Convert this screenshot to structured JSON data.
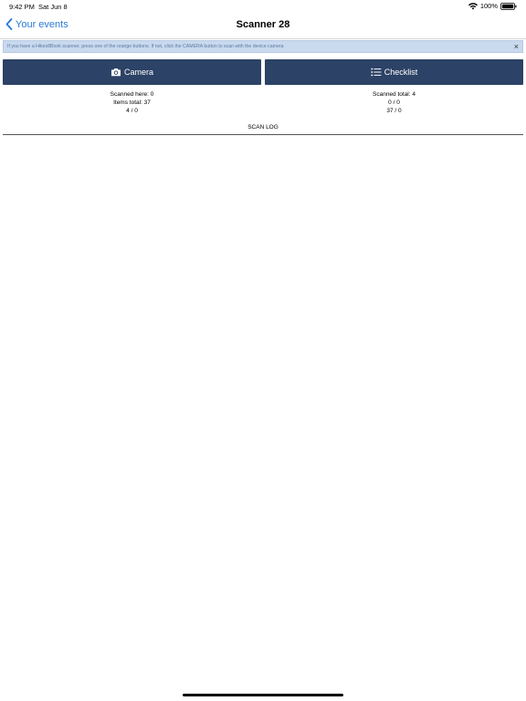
{
  "status_bar": {
    "time": "9:42 PM",
    "date": "Sat Jun 8",
    "battery": "100%"
  },
  "nav": {
    "back_label": "Your events",
    "title": "Scanner 28"
  },
  "banner": {
    "text": "If you have a Hikes8Book scanner, press one of the orange buttons. If not, click the CAMERA button to scan with the device camera",
    "close_glyph": "×"
  },
  "buttons": {
    "camera_label": "Camera",
    "checklist_label": "Checklist"
  },
  "stats_left": {
    "line1": "Scanned here: 0",
    "line2": "Items total: 37",
    "line3": "4 / 0"
  },
  "stats_right": {
    "line1": "Scanned total: 4",
    "line2": "0 / 0",
    "line3": "37 / 0"
  },
  "scan_log": {
    "label": "SCAN LOG"
  },
  "colors": {
    "accent": "#2a79d6",
    "button_bg": "#2c4266",
    "banner_bg": "#c9d9ee"
  },
  "icons": {
    "back": "chevron-left-icon",
    "wifi": "wifi-icon",
    "battery": "battery-icon",
    "camera": "camera-icon",
    "checklist": "list-icon",
    "close": "close-icon"
  }
}
